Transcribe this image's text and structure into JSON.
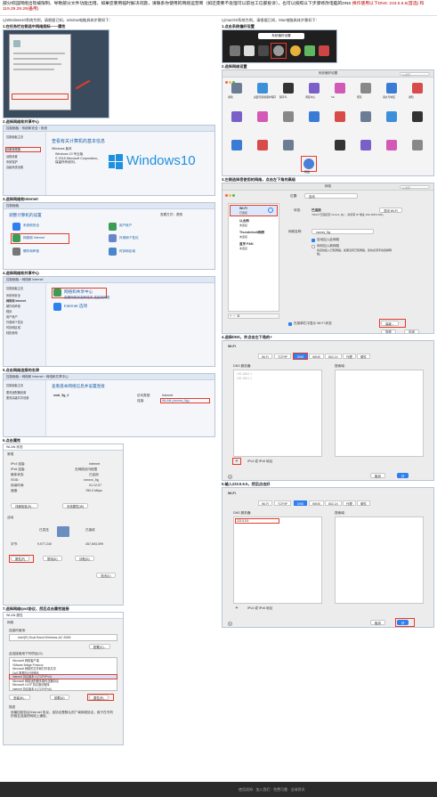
{
  "header": {
    "text_main": "部分校园网络出现被限制、导致部分文件功能出错。如果您要用临时解决问题，请联系你使用的网络运营商（如还需要不处理可以前往工信部投诉），也可以按照以下步骤修改电脑的DNS",
    "text_dns": "换作使用以下DNS: 223.5.5.5(首选) 和 119.29.29.29(备用)"
  },
  "left": {
    "intro": "以Windows10系统为例，请根据已知，window电脑具体步骤如下：",
    "steps": [
      "1.在任务栏右侧选中网络图标——属性",
      "2.选择网络和共享中心",
      "3.选择网络和Internet",
      "4.选择网络和共享中心",
      "5.点击网络连接的名称",
      "6.点击属性",
      "7.选择网络Ipv4协议，然后点击属性链接"
    ],
    "s2": {
      "breadcrumb": "控制面板 › 系统和安全 › 系统",
      "heading": "查看有关计算机的基本信息",
      "edition_label": "Windows 版本",
      "edition": "Windows 10 专业版",
      "copyright": "© 2018 Microsoft Corporation。保留所有权利。",
      "logo_text": "Windows10",
      "side_items": [
        "控制面板主页",
        "设备管理器",
        "远程设置",
        "系统保护",
        "高级系统设置"
      ]
    },
    "s3": {
      "breadcrumb": "控制面板",
      "heading": "调整计算机的设置",
      "view_by": "查看方式：类别",
      "items": [
        "系统和安全",
        "网络和 Internet",
        "硬件和声音",
        "用户帐户",
        "外观和个性化",
        "时钟和区域"
      ]
    },
    "s4": {
      "breadcrumb": "控制面板 › 网络和 Internet",
      "items": [
        "网络和共享中心",
        "Internet 选项"
      ],
      "item_desc": "查看网络状态和任务  连接到网络",
      "side_items": [
        "控制面板主页",
        "系统和安全",
        "网络和 Internet",
        "硬件和声音",
        "程序",
        "用户帐户",
        "外观和个性化",
        "时钟和区域",
        "轻松使用"
      ]
    },
    "s5": {
      "breadcrumb": "控制面板 › 网络和 Internet › 网络和共享中心",
      "heading": "查看基本网络信息并设置连接",
      "network_name": "ssid_5g_2",
      "access_label": "访问类型:",
      "access_value": "Internet",
      "conn_label": "连接:",
      "conn_value": "WLAN (xxxxxx_5g)",
      "side_items": [
        "控制面板主页",
        "更改适配器设置",
        "更改高级共享设置"
      ]
    },
    "s6": {
      "title": "WLAN 状态",
      "tab": "常规",
      "rows": [
        [
          "IPv4 连接:",
          "Internet"
        ],
        [
          "IPv6 连接:",
          "无网络访问权限"
        ],
        [
          "媒体状态:",
          "已启用"
        ],
        [
          "SSID:",
          "xxxxxx_5g"
        ],
        [
          "持续时间:",
          "01:12:07"
        ],
        [
          "速度:",
          "780.0 Mbps"
        ]
      ],
      "buttons": [
        "详细信息(E)...",
        "无线属性(W)"
      ],
      "activity": "活动",
      "sent": "已发送",
      "received": "已接收",
      "bytes_label": "字节:",
      "bytes_sent": "9,977,240",
      "bytes_recv": "457,693,099",
      "bottom_buttons": [
        "属性(P)",
        "禁用(D)",
        "诊断(G)"
      ],
      "close": "关闭(C)"
    },
    "s7": {
      "title": "WLAN 属性",
      "tab": "网络",
      "connect_using": "连接时使用:",
      "adapter": "Intel(R) Dual Band Wireless-AC 8265",
      "configure": "配置(C)...",
      "list_label": "此连接使用下列项目(O):",
      "list": [
        "Microsoft 网络客户端",
        "VMware Bridge Protocol",
        "Microsoft 网络的文件和打印机共享",
        "QoS 数据包计划程序",
        "Internet 协议版本 4 (TCP/IPv4)",
        "Microsoft 网络适配器多路传送器协议",
        "Microsoft LLDP 协议驱动程序",
        "Internet 协议版本 6 (TCP/IPv6)"
      ],
      "buttons": [
        "安装(N)...",
        "卸载(U)",
        "属性(R)"
      ],
      "desc_label": "描述",
      "desc": "传输控制协议/Internet 协议。该协议是默认的广域网络协议，用于在不同的相互连接的网络上通信。"
    }
  },
  "right": {
    "intro": "以macOS系统为例，请根据已知，Mac电脑具体步骤如下：",
    "steps": [
      "1.点击系统偏好设置",
      "2.选择网络设置",
      "3.左侧选择您使用的网络，点击左下角的高级",
      "4.选择DNS，并点击左下角的+",
      "5.输入223.5.5.5，然后点击好"
    ],
    "s1": {
      "tooltip": "系统偏好设置"
    },
    "s2": {
      "title": "系统偏好设置",
      "search": "Q 搜索",
      "row_labels": [
        "通用",
        "桌面与屏幕保护程序",
        "程序坞",
        "调度中心",
        "Siri",
        "聚焦",
        "语言与地区",
        "通知"
      ],
      "highlight_label": "网络"
    },
    "s3": {
      "title": "网络",
      "location_label": "位置:",
      "location_value": "自动",
      "list": [
        [
          "Wi-Fi",
          "已连接"
        ],
        [
          "以太网",
          "未连接"
        ],
        [
          "Thunderbolt网桥",
          "未连接"
        ],
        [
          "蓝牙 PAN",
          "未连接"
        ]
      ],
      "status_label": "状态:",
      "status_value": "已连接",
      "status_desc": "\"Wi-Fi\"已连接至\"xxxxxx_5g\"，并具有 IP 地址 192.168.0.100。",
      "turn_off": "关闭 Wi-Fi",
      "network_name_label": "网络名称:",
      "network_name": "xxxxxx_5g",
      "check1": "自动加入此网络",
      "check2": "询问加入新网络",
      "check2_desc": "将自动加入已知网络。如果没有已知网络，您将必须手动选择网络。",
      "show_wifi": "在菜单栏中显示 Wi-Fi 状态",
      "advanced": "高级...",
      "revert": "复原",
      "apply": "应用"
    },
    "s4": {
      "wifi": "Wi-Fi",
      "tabs": [
        "Wi-Fi",
        "TCP/IP",
        "DNS",
        "WINS",
        "802.1X",
        "代理",
        "硬件"
      ],
      "dns_label": "DNS 服务器:",
      "dns_values": [
        "192.168.0.1",
        "192.168.1.1"
      ],
      "search_label": "搜索域:",
      "ipv_label": "IPv4 或 IPv6 地址",
      "cancel": "取消",
      "ok": "好"
    },
    "s5": {
      "wifi": "Wi-Fi",
      "tabs": [
        "Wi-Fi",
        "TCP/IP",
        "DNS",
        "WINS",
        "802.1X",
        "代理",
        "硬件"
      ],
      "dns_label": "DNS 服务器:",
      "dns_value": "223.5.5.5",
      "search_label": "搜索域:",
      "ipv_label": "IPv4 或 IPv6 地址",
      "cancel": "取消",
      "ok": "好"
    }
  },
  "footer": {
    "text": "使用须知 · 加入我们 · 免费可靠 · 全球资讯"
  },
  "colors": {
    "highlight": "#e43b2a",
    "win_blue": "#1e90e0",
    "mac_blue": "#2f7ff0"
  }
}
